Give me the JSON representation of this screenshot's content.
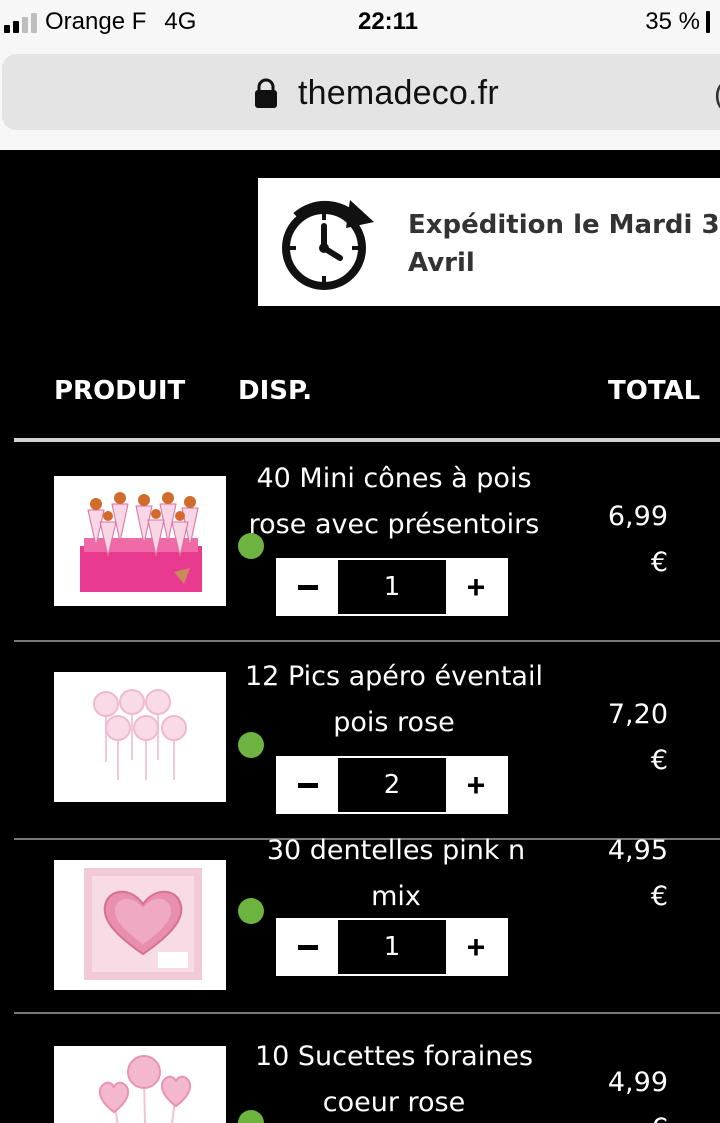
{
  "statusbar": {
    "carrier": "Orange F",
    "network": "4G",
    "time": "22:11",
    "battery": "35 %"
  },
  "browser": {
    "url": "themadeco.fr"
  },
  "shipping": {
    "text": "Expédition le Mardi 3 Avril",
    "icon": "clock-refresh-icon"
  },
  "table": {
    "headers": {
      "product": "PRODUIT",
      "availability": "DISP.",
      "total": "TOTAL"
    },
    "rows": [
      {
        "name_lines": [
          "40 Mini cônes à pois",
          "rose avec présentoirs"
        ],
        "quantity": "1",
        "price": "6,99",
        "currency": "€",
        "available": true
      },
      {
        "name_lines": [
          "12 Pics apéro éventail",
          "pois rose"
        ],
        "quantity": "2",
        "price": "7,20",
        "currency": "€",
        "available": true
      },
      {
        "name_lines": [
          "30 dentelles pink n mix"
        ],
        "quantity": "1",
        "price": "4,95",
        "currency": "€",
        "available": true
      },
      {
        "name_lines": [
          "10 Sucettes foraines",
          "coeur rose"
        ],
        "quantity": "",
        "price": "4,99",
        "currency": "€",
        "available": true
      }
    ],
    "stepper": {
      "minus": "−",
      "plus": "+"
    }
  },
  "colors": {
    "background": "#000000",
    "available_dot": "#6cb33f",
    "urlbar": "#e4e4e4"
  }
}
